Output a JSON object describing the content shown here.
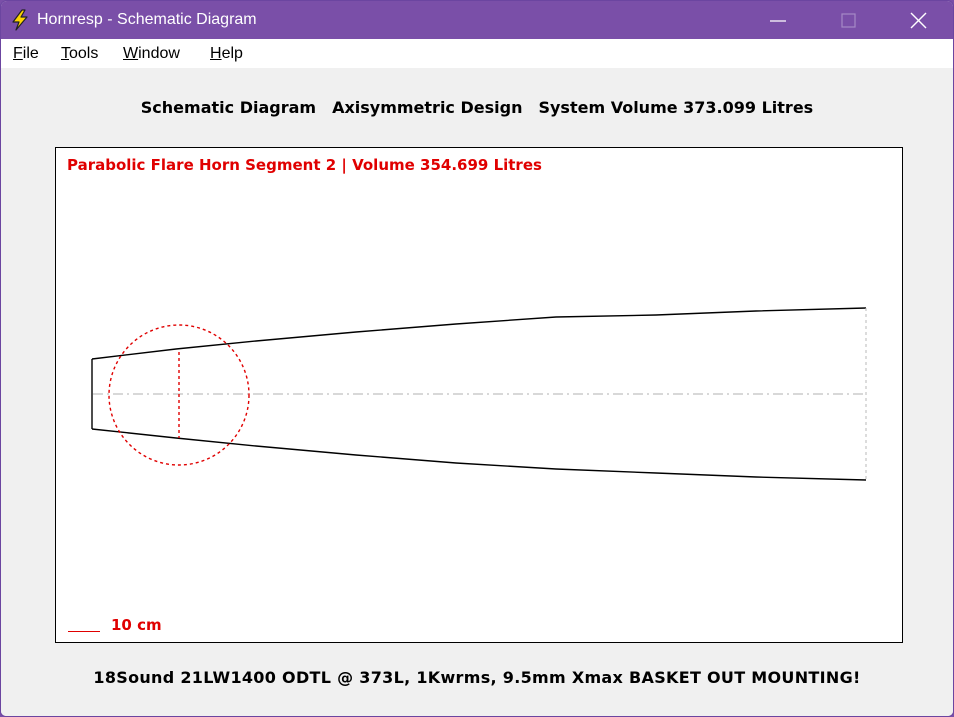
{
  "window": {
    "title": "Hornresp - Schematic Diagram",
    "titlebar_color": "#7a4fa8"
  },
  "menu": {
    "items": [
      {
        "label": "File",
        "accel": "F",
        "rest": "ile"
      },
      {
        "label": "Tools",
        "accel": "T",
        "rest": "ools"
      },
      {
        "label": "Window",
        "accel": "W",
        "rest": "indow"
      },
      {
        "label": "Help",
        "accel": "H",
        "rest": "elp"
      }
    ]
  },
  "header": {
    "part1": "Schematic Diagram",
    "part2": "Axisymmetric Design",
    "part3": "System Volume 373.099 Litres"
  },
  "diagram": {
    "segment_label": "Parabolic Flare Horn Segment 2 | Volume 354.699 Litres",
    "scale_label": "10 cm",
    "highlight_color": "#e00000"
  },
  "footer": {
    "text": "18Sound 21LW1400 ODTL @ 373L, 1Kwrms, 9.5mm Xmax BASKET OUT MOUNTING!"
  },
  "icons": {
    "app": "lightning-bolt-icon",
    "minimize": "minimize-icon",
    "maximize": "maximize-icon",
    "close": "close-icon"
  }
}
